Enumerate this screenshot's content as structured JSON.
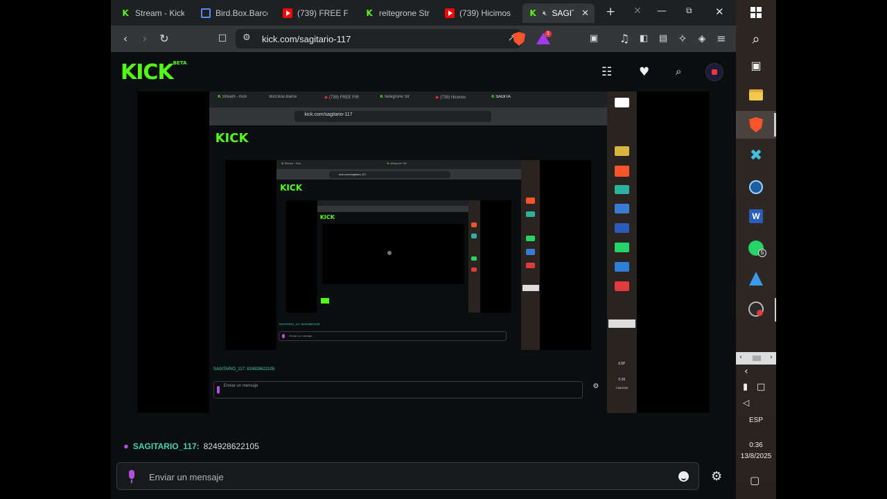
{
  "browser": {
    "tabs": [
      {
        "label": "Stream - Kick",
        "icon": "kick-icon"
      },
      {
        "label": "Bird.Box.Barce",
        "icon": "discord-icon"
      },
      {
        "label": "(739) FREE FIR",
        "icon": "youtube-icon"
      },
      {
        "label": "reitegrone Str",
        "icon": "kick-icon"
      },
      {
        "label": "(739) Hicimos",
        "icon": "youtube-icon"
      },
      {
        "label": "SAGITA",
        "icon": "kick-icon",
        "active": true
      }
    ],
    "url": "kick.com/sagitario-117"
  },
  "kick": {
    "logo": "KICK",
    "logo_tag": "BETA",
    "chat": {
      "username": "SAGITARIO_117:",
      "message": "824928622105"
    },
    "input_placeholder": "Enviar un mensaje"
  },
  "nested_stream": {
    "url": "kick.com/sagitario-117",
    "logo": "KICK",
    "tabs": [
      "Stream - Kick",
      "Bird.Box.Barce",
      "(739) FREE FIR",
      "reitegrone Str",
      "(739) Hicimos",
      "SAGITA"
    ],
    "chat_line": "SAGITARIO_117: 824928622105",
    "input_placeholder": "Enviar un mensaje",
    "tray_lang": "ESP",
    "tray_time": "0:36",
    "tray_date": "13/8/2025"
  },
  "taskbar": {
    "lang": "ESP",
    "time": "0:36",
    "date": "13/8/2025",
    "whatsapp_badge": "5",
    "brave_badge": "1",
    "colors": {
      "kick_green": "#53fc18",
      "brave_orange": "#fb542b",
      "mic_purple": "#b24ee0"
    }
  }
}
